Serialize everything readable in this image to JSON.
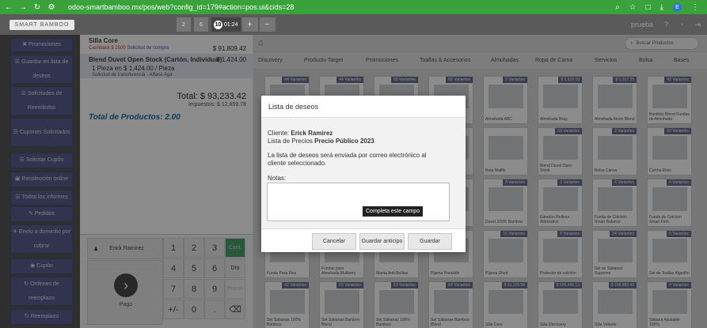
{
  "browser": {
    "url": "odoo-smartbamboo.mx/pos/web?config_id=179#action=pos.ui&cids=28"
  },
  "pos": {
    "logo": "SMART BAMBOO",
    "sessions": [
      "2",
      "6"
    ],
    "active_session": {
      "number": "10",
      "time": "01:24"
    },
    "user": "prueba",
    "help": "?"
  },
  "sidebar": [
    {
      "icon": "✖",
      "label": "Promociones"
    },
    {
      "icon": "☰",
      "label": "Guardar en lista de deseos"
    },
    {
      "icon": "☰",
      "label": "Solicitudes de Reembolso"
    },
    {
      "icon": "☰",
      "label": "Cupones Solicitados"
    },
    {
      "icon": "☰",
      "label": "Solicitar Cupón"
    },
    {
      "icon": "▣",
      "label": "Recolección online"
    },
    {
      "icon": "☰",
      "label": "Todos los informes"
    },
    {
      "icon": "✎",
      "label": "Pedidos"
    },
    {
      "icon": "✈",
      "label": "Envío a domicilio por cobrar"
    },
    {
      "icon": "◉",
      "label": "Cupón"
    },
    {
      "icon": "↻",
      "label": "Ordenes de reemplazo"
    },
    {
      "icon": "↻",
      "label": "Reemplazo"
    }
  ],
  "order": {
    "lines": [
      {
        "name": "Silla Core",
        "price": "$ 91,809.42",
        "sub1": "Cashback $ 2500",
        "sub2": "Solicitud de compra"
      },
      {
        "name": "Blend Duvet Open Stock (Cartón, Individual)",
        "price": "$ 1,424.00",
        "qty": "1 Pieza en $ 1,424.00 / Pieza",
        "note": "Solicitud de transferencia - Alfaria Aga"
      }
    ],
    "total": "Total: $ 93,233.42",
    "taxes": "Impuestos: $ 12,859.78",
    "total_products": "Total de Productos: 2.00"
  },
  "numpad": {
    "customer": "Erick Ramirez",
    "pay": "Pago",
    "keys": [
      "1",
      "2",
      "3",
      "Cant.",
      "4",
      "5",
      "6",
      "Dto",
      "7",
      "8",
      "9",
      "Precio",
      "+/-",
      "0",
      ".",
      "⌫"
    ]
  },
  "catalog": {
    "search_placeholder": "Buscar Productos",
    "categories": [
      "Discovery",
      "Producto Target",
      "Promociones",
      "Toallas & Accesorios",
      "Almohadas",
      "Ropa de Cama",
      "Servicios",
      "Bolsa",
      "Bases"
    ],
    "products": [
      {
        "tag": "44 Variantes",
        "name": ""
      },
      {
        "tag": "44 Variantes",
        "name": ""
      },
      {
        "tag": "65 Variantes",
        "name": ""
      },
      {
        "tag": "66 Variantes",
        "name": ""
      },
      {
        "tag": "2 Variantes",
        "name": "Almohada ABC"
      },
      {
        "tag": "$ 2,923.15",
        "name": "Almohada Bsay"
      },
      {
        "tag": "$ 1,317.25",
        "name": "Almohada Moon Blend"
      },
      {
        "tag": "42 Variantes",
        "name": "Bamboo Blend Fundas de Almohada"
      },
      {
        "tag": "",
        "name": ""
      },
      {
        "tag": "",
        "name": ""
      },
      {
        "tag": "",
        "name": ""
      },
      {
        "tag": "",
        "name": ""
      },
      {
        "tag": "",
        "name": "Bata Waffle"
      },
      {
        "tag": "63 Variantes",
        "name": "Blend Duvet Open Stock"
      },
      {
        "tag": "2 Variantes",
        "name": "Bolsa Canva"
      },
      {
        "tag": "33 Variantes",
        "name": "Colcha Elvio"
      },
      {
        "tag": "",
        "name": ""
      },
      {
        "tag": "",
        "name": ""
      },
      {
        "tag": "",
        "name": ""
      },
      {
        "tag": "",
        "name": ""
      },
      {
        "tag": "8 Variantes",
        "name": "Duvet 100% Bamboo"
      },
      {
        "tag": "3 Variantes",
        "name": "Edredón Relleno Alternativo"
      },
      {
        "tag": "4 Variantes",
        "name": "Funda de Colchón Smart Balance"
      },
      {
        "tag": "4 Variantes",
        "name": "Funda de Colchón Smart Firm"
      },
      {
        "tag": "",
        "name": "Funda Para Pies"
      },
      {
        "tag": "",
        "name": "Fundas para Almohada Mulberry"
      },
      {
        "tag": "",
        "name": "Manta Anti-Bolitas"
      },
      {
        "tag": "",
        "name": "Pijama Pantalón"
      },
      {
        "tag": "16 Variantes",
        "name": "Pijama Short"
      },
      {
        "tag": "4 Variantes",
        "name": "Protector de colchón"
      },
      {
        "tag": "24 Variantes",
        "name": "Set de Sábanas Supreme"
      },
      {
        "tag": "6 Variantes",
        "name": "Set de Toallas Algodón"
      },
      {
        "tag": "42 Variantes",
        "name": "Set Sábanas 100% Bamboo"
      },
      {
        "tag": "63 Variantes",
        "name": "Set Sábanas Bamboo Blend"
      },
      {
        "tag": "63 Variantes",
        "name": "Set Sábanas 100% Bamboo"
      },
      {
        "tag": "84 Variantes",
        "name": "Set Sábanas Bamboo Blend"
      },
      {
        "tag": "$ 91,125.56",
        "name": "Silla Core"
      },
      {
        "tag": "$ 106,406.13",
        "name": "Silla Discovery"
      },
      {
        "tag": "$ 108,886.42",
        "name": "Silla Volante"
      },
      {
        "tag": "4 Variantes",
        "name": "Sábana Ajustable 100%"
      }
    ]
  },
  "modal": {
    "title": "Lista de deseos",
    "client_label": "Cliente:",
    "client": "Erick Ramirez",
    "pricelist_label": "Lista de Precios",
    "pricelist": "Precio Público 2023",
    "info": "La lista de deseos será enviada por correo electrónico al cliente seleccionado.",
    "notes_label": "Notas:",
    "tooltip": "Completa este campo",
    "cancel": "Cancelar",
    "save_advance": "Guardar anticipo",
    "save": "Guardar"
  }
}
